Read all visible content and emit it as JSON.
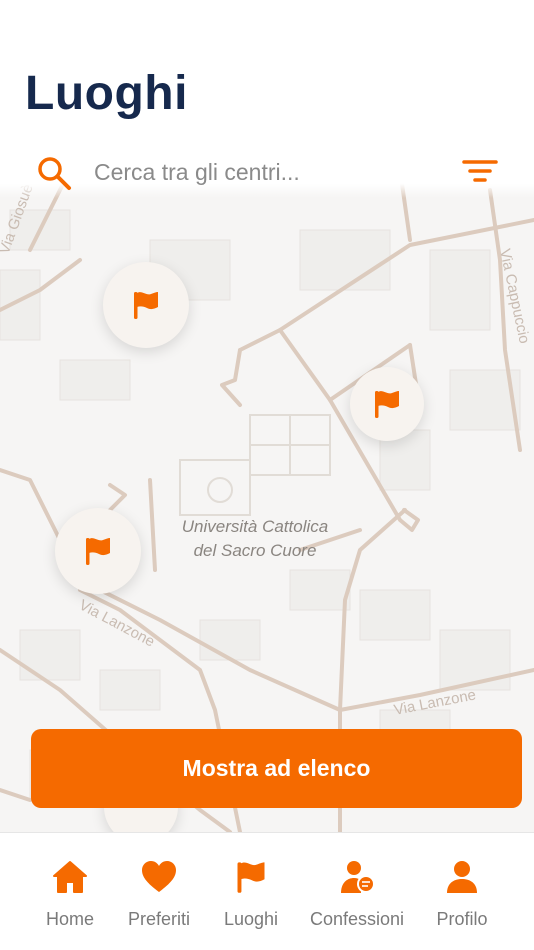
{
  "header": {
    "title": "Luoghi"
  },
  "search": {
    "placeholder": "Cerca tra gli centri..."
  },
  "map": {
    "labels": {
      "university_line1": "Università Cattolica",
      "university_line2": "del Sacro Cuore",
      "street_lanzone_1": "Via Lanzone",
      "street_lanzone_2": "Via Lanzone",
      "street_cappuccio": "Via Cappuccio",
      "street_top_left": "Via Giosuè"
    },
    "markers": [
      "flag-marker",
      "flag-marker",
      "flag-marker",
      "flag-marker"
    ]
  },
  "actions": {
    "show_list_label": "Mostra ad elenco"
  },
  "nav": {
    "items": [
      {
        "label": "Home",
        "icon": "home-icon"
      },
      {
        "label": "Preferiti",
        "icon": "heart-icon"
      },
      {
        "label": "Luoghi",
        "icon": "flag-icon"
      },
      {
        "label": "Confessioni",
        "icon": "confession-icon"
      },
      {
        "label": "Profilo",
        "icon": "profile-icon"
      }
    ]
  },
  "colors": {
    "accent": "#f56a00",
    "title": "#16294d",
    "nav_label": "#7a7a7a",
    "map_bg": "#f6f5f4",
    "road": "#d9c8bb"
  }
}
